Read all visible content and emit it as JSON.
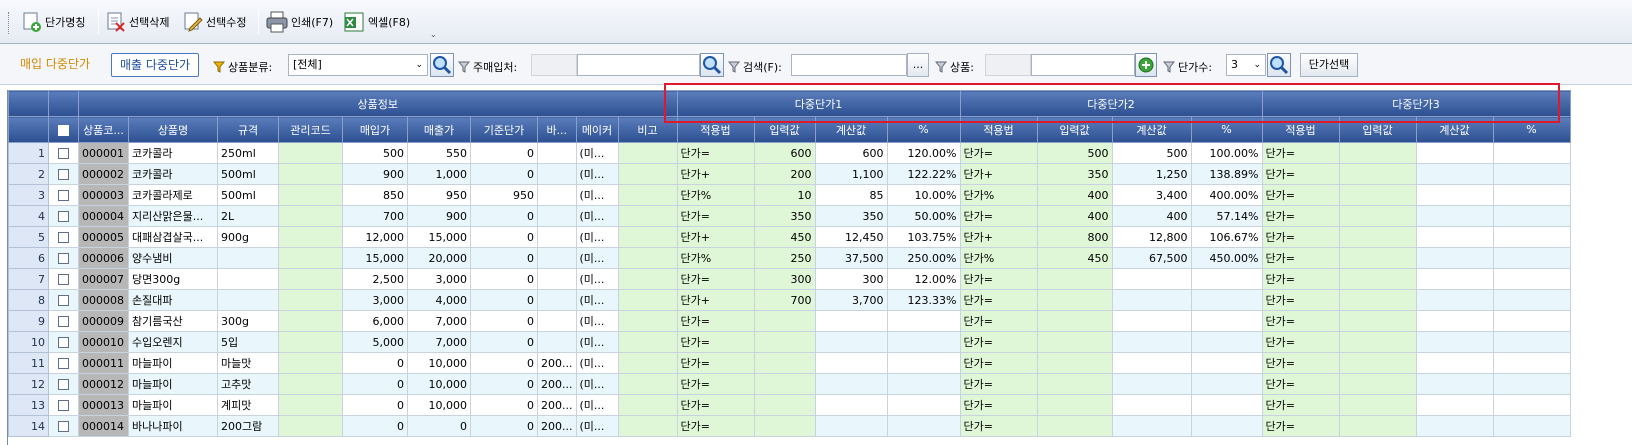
{
  "toolbar": {
    "items": [
      {
        "label": "단가명칭",
        "icon": "add-name-icon"
      },
      {
        "label": "선택삭제",
        "icon": "delete-doc-icon"
      },
      {
        "label": "선택수정",
        "icon": "edit-pen-icon"
      },
      {
        "label": "인쇄(F7)",
        "icon": "printer-icon"
      },
      {
        "label": "엑셀(F8)",
        "icon": "excel-icon"
      }
    ],
    "overflow": "⌄"
  },
  "filters": {
    "tab_purchase": "매입 다중단가",
    "tab_sales": "매출 다중단가",
    "category_label": "상품분류:",
    "category_value": "[전체]",
    "vendor_label": "주매입처:",
    "vendor_value": "",
    "search_label": "검색(F):",
    "search_value": "",
    "search_more": "...",
    "product_label": "상품:",
    "product_value": "",
    "count_label": "단가수:",
    "count_value": "3",
    "select_button": "단가선택"
  },
  "grid": {
    "group_headers": [
      "상품정보",
      "다중단가1",
      "다중단가2",
      "다중단가3"
    ],
    "columns": [
      "상품코...",
      "상품명",
      "규격",
      "관리코드",
      "매입가",
      "매출가",
      "기준단가",
      "바...",
      "메이커",
      "비고",
      "적용법",
      "입력값",
      "계산값",
      "%",
      "적용법",
      "입력값",
      "계산값",
      "%",
      "적용법",
      "입력값",
      "계산값",
      "%"
    ],
    "rows": [
      {
        "n": "1",
        "code": "000001",
        "name": "코카콜라",
        "spec": "250ml",
        "mgmt": "",
        "buy": "500",
        "sell": "550",
        "base": "0",
        "bar": "",
        "maker": "(미...",
        "note": "",
        "p1": [
          "단가=",
          "600",
          "600",
          "120.00%"
        ],
        "p2": [
          "단가=",
          "500",
          "500",
          "100.00%"
        ],
        "p3": [
          "단가=",
          "",
          "",
          ""
        ]
      },
      {
        "n": "2",
        "code": "000002",
        "name": "코카콜라",
        "spec": "500ml",
        "mgmt": "",
        "buy": "900",
        "sell": "1,000",
        "base": "0",
        "bar": "",
        "maker": "(미...",
        "note": "",
        "p1": [
          "단가+",
          "200",
          "1,100",
          "122.22%"
        ],
        "p2": [
          "단가+",
          "350",
          "1,250",
          "138.89%"
        ],
        "p3": [
          "단가=",
          "",
          "",
          ""
        ]
      },
      {
        "n": "3",
        "code": "000003",
        "name": "코카콜라제로",
        "spec": "500ml",
        "mgmt": "",
        "buy": "850",
        "sell": "950",
        "base": "950",
        "bar": "",
        "maker": "(미...",
        "note": "",
        "p1": [
          "단가%",
          "10",
          "85",
          "10.00%"
        ],
        "p2": [
          "단가%",
          "400",
          "3,400",
          "400.00%"
        ],
        "p3": [
          "단가=",
          "",
          "",
          ""
        ]
      },
      {
        "n": "4",
        "code": "000004",
        "name": "지리산맑은물...",
        "spec": "2L",
        "mgmt": "",
        "buy": "700",
        "sell": "900",
        "base": "0",
        "bar": "",
        "maker": "(미...",
        "note": "",
        "p1": [
          "단가=",
          "350",
          "350",
          "50.00%"
        ],
        "p2": [
          "단가=",
          "400",
          "400",
          "57.14%"
        ],
        "p3": [
          "단가=",
          "",
          "",
          ""
        ]
      },
      {
        "n": "5",
        "code": "000005",
        "name": "대패삼겹살국...",
        "spec": "900g",
        "mgmt": "",
        "buy": "12,000",
        "sell": "15,000",
        "base": "0",
        "bar": "",
        "maker": "(미...",
        "note": "",
        "p1": [
          "단가+",
          "450",
          "12,450",
          "103.75%"
        ],
        "p2": [
          "단가+",
          "800",
          "12,800",
          "106.67%"
        ],
        "p3": [
          "단가=",
          "",
          "",
          ""
        ]
      },
      {
        "n": "6",
        "code": "000006",
        "name": "양수냄비",
        "spec": "",
        "mgmt": "",
        "buy": "15,000",
        "sell": "20,000",
        "base": "0",
        "bar": "",
        "maker": "(미...",
        "note": "",
        "p1": [
          "단가%",
          "250",
          "37,500",
          "250.00%"
        ],
        "p2": [
          "단가%",
          "450",
          "67,500",
          "450.00%"
        ],
        "p3": [
          "단가=",
          "",
          "",
          ""
        ]
      },
      {
        "n": "7",
        "code": "000007",
        "name": "당면300g",
        "spec": "",
        "mgmt": "",
        "buy": "2,500",
        "sell": "3,000",
        "base": "0",
        "bar": "",
        "maker": "(미...",
        "note": "",
        "p1": [
          "단가=",
          "300",
          "300",
          "12.00%"
        ],
        "p2": [
          "단가=",
          "",
          "",
          ""
        ],
        "p3": [
          "단가=",
          "",
          "",
          ""
        ]
      },
      {
        "n": "8",
        "code": "000008",
        "name": "손질대파",
        "spec": "",
        "mgmt": "",
        "buy": "3,000",
        "sell": "4,000",
        "base": "0",
        "bar": "",
        "maker": "(미...",
        "note": "",
        "p1": [
          "단가+",
          "700",
          "3,700",
          "123.33%"
        ],
        "p2": [
          "단가=",
          "",
          "",
          ""
        ],
        "p3": [
          "단가=",
          "",
          "",
          ""
        ]
      },
      {
        "n": "9",
        "code": "000009",
        "name": "참기름국산",
        "spec": "300g",
        "mgmt": "",
        "buy": "6,000",
        "sell": "7,000",
        "base": "0",
        "bar": "",
        "maker": "(미...",
        "note": "",
        "p1": [
          "단가=",
          "",
          "",
          ""
        ],
        "p2": [
          "단가=",
          "",
          "",
          ""
        ],
        "p3": [
          "단가=",
          "",
          "",
          ""
        ]
      },
      {
        "n": "10",
        "code": "000010",
        "name": "수입오렌지",
        "spec": "5입",
        "mgmt": "",
        "buy": "5,000",
        "sell": "7,000",
        "base": "0",
        "bar": "",
        "maker": "(미...",
        "note": "",
        "p1": [
          "단가=",
          "",
          "",
          ""
        ],
        "p2": [
          "단가=",
          "",
          "",
          ""
        ],
        "p3": [
          "단가=",
          "",
          "",
          ""
        ]
      },
      {
        "n": "11",
        "code": "000011",
        "name": "마늘파이",
        "spec": "마늘맛",
        "mgmt": "",
        "buy": "0",
        "sell": "10,000",
        "base": "0",
        "bar": "200...",
        "maker": "(미...",
        "note": "",
        "p1": [
          "단가=",
          "",
          "",
          ""
        ],
        "p2": [
          "단가=",
          "",
          "",
          ""
        ],
        "p3": [
          "단가=",
          "",
          "",
          ""
        ]
      },
      {
        "n": "12",
        "code": "000012",
        "name": "마늘파이",
        "spec": "고추맛",
        "mgmt": "",
        "buy": "0",
        "sell": "10,000",
        "base": "0",
        "bar": "200...",
        "maker": "(미...",
        "note": "",
        "p1": [
          "단가=",
          "",
          "",
          ""
        ],
        "p2": [
          "단가=",
          "",
          "",
          ""
        ],
        "p3": [
          "단가=",
          "",
          "",
          ""
        ]
      },
      {
        "n": "13",
        "code": "000013",
        "name": "마늘파이",
        "spec": "계피맛",
        "mgmt": "",
        "buy": "0",
        "sell": "10,000",
        "base": "0",
        "bar": "200...",
        "maker": "(미...",
        "note": "",
        "p1": [
          "단가=",
          "",
          "",
          ""
        ],
        "p2": [
          "단가=",
          "",
          "",
          ""
        ],
        "p3": [
          "단가=",
          "",
          "",
          ""
        ]
      },
      {
        "n": "14",
        "code": "000014",
        "name": "바나나파이",
        "spec": "200그람",
        "mgmt": "",
        "buy": "0",
        "sell": "0",
        "base": "0",
        "bar": "200...",
        "maker": "(미...",
        "note": "",
        "p1": [
          "단가=",
          "",
          "",
          ""
        ],
        "p2": [
          "단가=",
          "",
          "",
          ""
        ],
        "p3": [
          "단가=",
          "",
          "",
          ""
        ]
      }
    ]
  },
  "colors": {
    "header": "#2c4f91",
    "highlight": "#e0182d",
    "green_cell": "#dff7d6",
    "alt_row": "#e9f6fb",
    "active_tab": "#d08a00"
  }
}
